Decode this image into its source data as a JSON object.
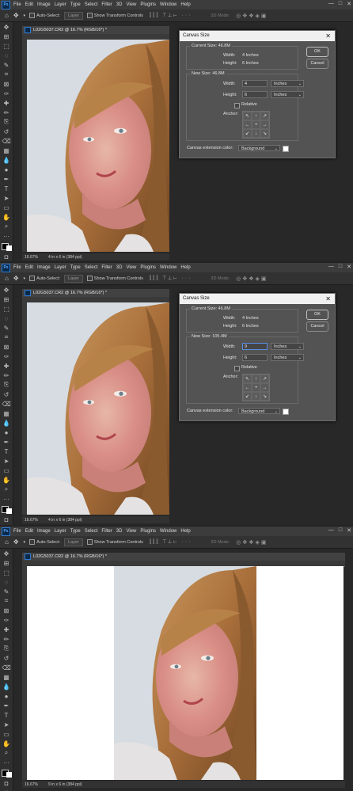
{
  "menu": {
    "app_icon": "Ps",
    "items": [
      "File",
      "Edit",
      "Image",
      "Layer",
      "Type",
      "Select",
      "Filter",
      "3D",
      "View",
      "Plugins",
      "Window",
      "Help"
    ],
    "window_controls": [
      "—",
      "□",
      "✕"
    ]
  },
  "options": {
    "auto_select_label": "Auto-Select:",
    "layer_label": "Layer",
    "transform_label": "Show Transform Controls",
    "mode_3d": "3D Mode:"
  },
  "document": {
    "tab_title": "L02G5037.CR2 @ 16.7% (RGB/16*) *",
    "zoom": "16.67%"
  },
  "colors": {
    "app_bg": "#232323",
    "dialog_bg": "#535353",
    "focus_blue": "#5b8ee6"
  },
  "panels": [
    {
      "status": "4 in x 6 in (384 ppi)",
      "dialog": {
        "title": "Canvas Size",
        "current_size_label": "Current Size: 46.8M",
        "cur_width_label": "Width:",
        "cur_width_value": "4 Inches",
        "cur_height_label": "Height:",
        "cur_height_value": "6 Inches",
        "new_size_label": "New Size: 46.8M",
        "width_label": "Width:",
        "width_value": "4",
        "width_unit": "Inches",
        "height_label": "Height:",
        "height_value": "6",
        "height_unit": "Inches",
        "relative_label": "Relative",
        "anchor_label": "Anchor:",
        "extension_label": "Canvas extension color:",
        "extension_value": "Background",
        "ok_label": "OK",
        "cancel_label": "Cancel"
      }
    },
    {
      "status": "4 in x 6 in (384 ppi)",
      "dialog": {
        "title": "Canvas Size",
        "current_size_label": "Current Size: 46.8M",
        "cur_width_label": "Width:",
        "cur_width_value": "4 Inches",
        "cur_height_label": "Height:",
        "cur_height_value": "6 Inches",
        "new_size_label": "New Size: 105.4M",
        "width_label": "Width:",
        "width_value": "9",
        "width_unit": "Inches",
        "height_label": "Height:",
        "height_value": "6",
        "height_unit": "Inches",
        "relative_label": "Relative",
        "anchor_label": "Anchor:",
        "extension_label": "Canvas extension color:",
        "extension_value": "Background",
        "ok_label": "OK",
        "cancel_label": "Cancel"
      }
    },
    {
      "status": "9 in x 6 in (384 ppi)"
    }
  ],
  "anchor_arrows": [
    "↖",
    "↑",
    "↗",
    "←",
    "•",
    "→",
    "↙",
    "↓",
    "↘"
  ],
  "tools": [
    "move-tool",
    "artboard-tool",
    "marquee-tool",
    "lasso-tool",
    "quick-select-tool",
    "crop-tool",
    "frame-tool",
    "eyedropper-tool",
    "healing-tool",
    "brush-tool",
    "clone-stamp-tool",
    "history-brush-tool",
    "eraser-tool",
    "gradient-tool",
    "blur-tool",
    "dodge-tool",
    "pen-tool",
    "type-tool",
    "path-select-tool",
    "rectangle-tool",
    "hand-tool",
    "zoom-tool",
    "more-tools",
    "color-swatches",
    "quick-mask-tool",
    "screen-mode-tool"
  ]
}
